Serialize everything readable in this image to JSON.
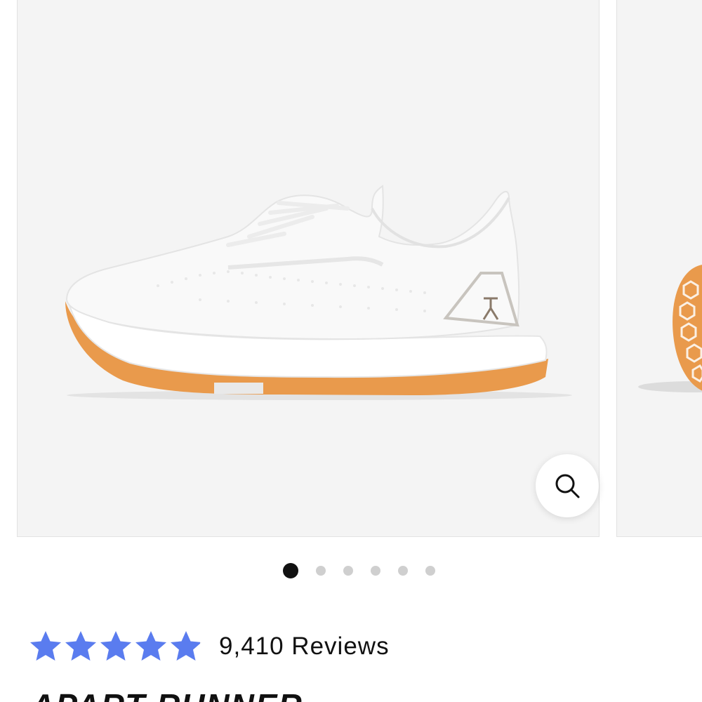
{
  "gallery": {
    "images": [
      {
        "alt": "white knit running shoe with orange outsole",
        "icon": "shoe-image"
      },
      {
        "alt": "orange honeycomb outsole",
        "icon": "shoe-sole-image"
      }
    ],
    "zoom_icon": "magnifier-icon",
    "dot_count": 6,
    "active_index": 0
  },
  "rating": {
    "stars": 4.9,
    "max": 5,
    "star_color": "#5a7cef",
    "reviews_label": "9,410 Reviews"
  },
  "product": {
    "title": "APART RUNNER"
  },
  "colors": {
    "image_bg": "#f4f4f4",
    "sole_orange": "#e99a4c",
    "active_dot": "#111111",
    "inactive_dot": "#cfcfcf"
  }
}
